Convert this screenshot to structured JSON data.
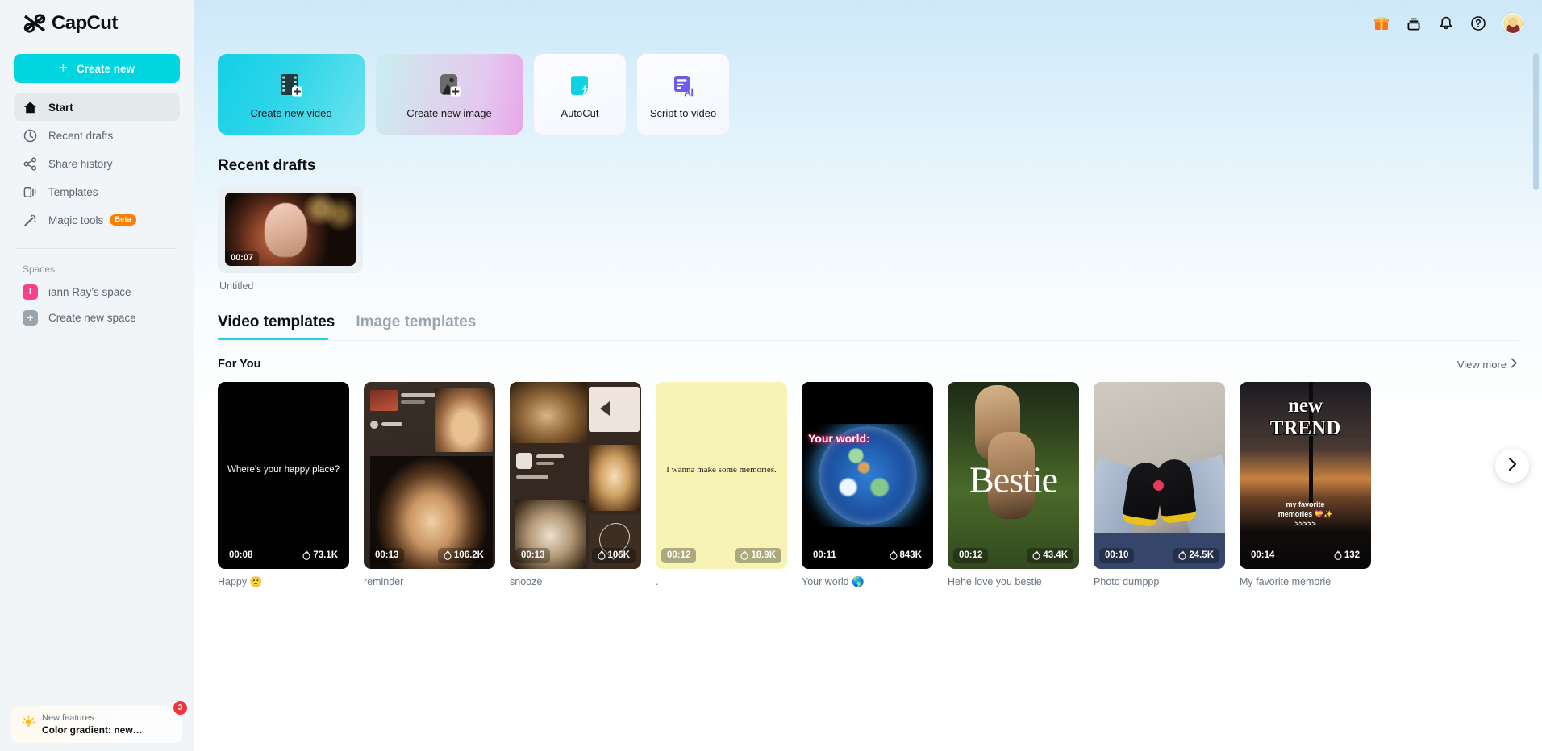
{
  "app": {
    "name": "CapCut"
  },
  "sidebar": {
    "create_new_label": "Create new",
    "nav": [
      {
        "label": "Start",
        "icon": "home-icon"
      },
      {
        "label": "Recent drafts",
        "icon": "clock-icon"
      },
      {
        "label": "Share history",
        "icon": "share-icon"
      },
      {
        "label": "Templates",
        "icon": "templates-icon"
      },
      {
        "label": "Magic tools",
        "icon": "magic-wand-icon",
        "badge": "Beta"
      }
    ],
    "spaces_label": "Spaces",
    "spaces": [
      {
        "label": "iann Ray’s space",
        "initial": "I"
      },
      {
        "label": "Create new space",
        "initial": "+"
      }
    ],
    "notification": {
      "title": "New features",
      "subtitle": "Color gradient: new…",
      "count": "3",
      "icon": "lightbulb-icon"
    }
  },
  "topbar": {
    "icons": [
      {
        "name": "gift-icon"
      },
      {
        "name": "archive-icon"
      },
      {
        "name": "bell-icon"
      },
      {
        "name": "help-icon"
      }
    ],
    "avatar": "user-avatar"
  },
  "action_cards": [
    {
      "label": "Create new video",
      "icon": "film-plus-icon",
      "style": "video"
    },
    {
      "label": "Create new image",
      "icon": "image-plus-icon",
      "style": "image"
    },
    {
      "label": "AutoCut",
      "icon": "autocut-icon",
      "style": "plain"
    },
    {
      "label": "Script to video",
      "icon": "script-ai-icon",
      "style": "plain"
    }
  ],
  "recent_drafts": {
    "title": "Recent drafts",
    "items": [
      {
        "name": "Untitled",
        "duration": "00:07"
      }
    ]
  },
  "tabs": [
    {
      "label": "Video templates",
      "active": true
    },
    {
      "label": "Image templates",
      "active": false
    }
  ],
  "for_you": {
    "title": "For You",
    "view_more": "View more",
    "templates": [
      {
        "name": "Happy 🙂",
        "duration": "00:08",
        "uses": "73.1K",
        "caption": "Where's your happy place?"
      },
      {
        "name": "reminder",
        "duration": "00:13",
        "uses": "106.2K"
      },
      {
        "name": "snooze",
        "duration": "00:13",
        "uses": "106K"
      },
      {
        "name": ".",
        "duration": "00:12",
        "uses": "18.9K",
        "caption": "I wanna make some memories."
      },
      {
        "name": "Your world 🌎",
        "duration": "00:11",
        "uses": "843K",
        "caption": "Your world:"
      },
      {
        "name": "Hehe love you bestie",
        "duration": "00:12",
        "uses": "43.4K",
        "caption": "Bestie"
      },
      {
        "name": "Photo dumppp",
        "duration": "00:10",
        "uses": "24.5K"
      },
      {
        "name": "My favorite memorie",
        "duration": "00:14",
        "uses": "132",
        "caption_1": "new",
        "caption_2": "TREND",
        "caption_3": "my favorite\nmemories 💝✨\n>>>>>"
      }
    ]
  },
  "colors": {
    "accent": "#00d5e0",
    "beta_badge": "#ff7d00",
    "notification_badge": "#f5333f",
    "space_pink": "#f7418f",
    "tab_underline": "#23d2e2",
    "script_purple": "#6c5ce7"
  }
}
